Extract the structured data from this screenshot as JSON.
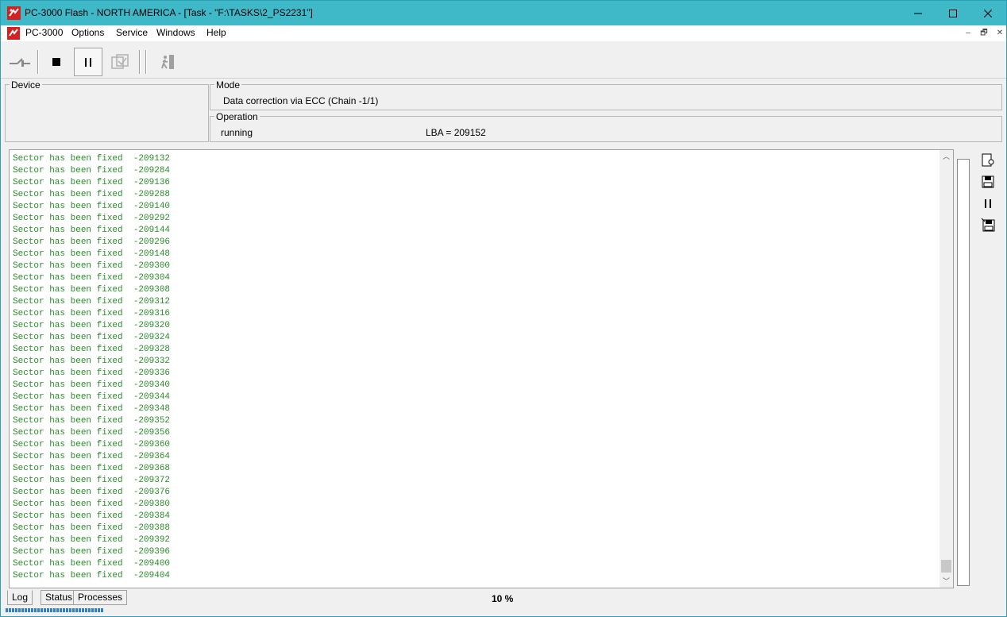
{
  "window": {
    "title": "PC-3000 Flash - NORTH AMERICA - [Task - \"F:\\TASKS\\2_PS2231\"]",
    "minimize": "—",
    "maximize": "☐",
    "close": "✕"
  },
  "menu": {
    "items": [
      "PC-3000",
      "Options",
      "Service",
      "Windows",
      "Help"
    ],
    "mdi_minimize": "–",
    "mdi_restore": "🗗",
    "mdi_close": "✕"
  },
  "groups": {
    "device_label": "Device",
    "mode_label": "Mode",
    "mode_value": "Data correction via ECC (Chain -1/1)",
    "operation_label": "Operation",
    "operation_status": "running",
    "operation_lba": "LBA = 209152"
  },
  "log": {
    "lines": [
      "Sector has been fixed  -209132",
      "Sector has been fixed  -209284",
      "Sector has been fixed  -209136",
      "Sector has been fixed  -209288",
      "Sector has been fixed  -209140",
      "Sector has been fixed  -209292",
      "Sector has been fixed  -209144",
      "Sector has been fixed  -209296",
      "Sector has been fixed  -209148",
      "Sector has been fixed  -209300",
      "Sector has been fixed  -209304",
      "Sector has been fixed  -209308",
      "Sector has been fixed  -209312",
      "Sector has been fixed  -209316",
      "Sector has been fixed  -209320",
      "Sector has been fixed  -209324",
      "Sector has been fixed  -209328",
      "Sector has been fixed  -209332",
      "Sector has been fixed  -209336",
      "Sector has been fixed  -209340",
      "Sector has been fixed  -209344",
      "Sector has been fixed  -209348",
      "Sector has been fixed  -209352",
      "Sector has been fixed  -209356",
      "Sector has been fixed  -209360",
      "Sector has been fixed  -209364",
      "Sector has been fixed  -209368",
      "Sector has been fixed  -209372",
      "Sector has been fixed  -209376",
      "Sector has been fixed  -209380",
      "Sector has been fixed  -209384",
      "Sector has been fixed  -209388",
      "Sector has been fixed  -209392",
      "Sector has been fixed  -209396",
      "Sector has been fixed  -209400",
      "Sector has been fixed  -209404"
    ],
    "text_color": "#2a8c2a"
  },
  "tabs": [
    "Log",
    "Status",
    "Processes"
  ],
  "status": {
    "percent_label": "10 %",
    "progress_fraction": 0.1
  },
  "colors": {
    "titlebar": "#3fb8c8",
    "progress": "#2f7fd6",
    "icon_red": "#d42020"
  }
}
